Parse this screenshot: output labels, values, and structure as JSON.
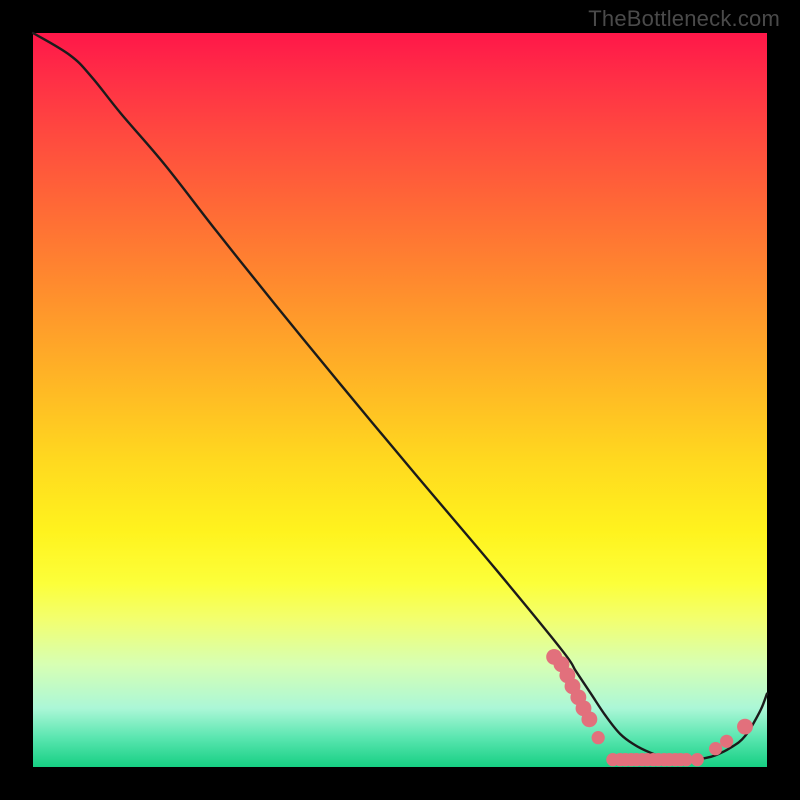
{
  "watermark": "TheBottleneck.com",
  "colors": {
    "background": "#000000",
    "curve_stroke": "#1b1b1b",
    "scatter_fill": "#e2707c",
    "gradient_top": "#ff1749",
    "gradient_bottom": "#16cf83"
  },
  "chart_data": {
    "type": "line",
    "title": "",
    "xlabel": "",
    "ylabel": "",
    "xlim": [
      0,
      100
    ],
    "ylim": [
      0,
      100
    ],
    "series": [
      {
        "name": "bottleneck-curve",
        "x": [
          0,
          5,
          8,
          12,
          18,
          25,
          33,
          42,
          52,
          63,
          72,
          74,
          76,
          78,
          80,
          82,
          84,
          86,
          88,
          90,
          91.5,
          93,
          95,
          97,
          99,
          100
        ],
        "y": [
          100,
          97,
          94,
          89,
          82,
          73,
          63,
          52,
          40,
          27,
          16,
          13,
          10,
          7,
          4.5,
          3,
          2,
          1.3,
          1,
          1,
          1.2,
          1.6,
          2.6,
          4.2,
          7.5,
          10
        ]
      }
    ],
    "scatter": {
      "name": "sweet-spot-markers",
      "points": [
        {
          "x": 71,
          "y": 15,
          "r": 1.2
        },
        {
          "x": 72,
          "y": 14,
          "r": 1.2
        },
        {
          "x": 72.8,
          "y": 12.5,
          "r": 1.2
        },
        {
          "x": 73.5,
          "y": 11,
          "r": 1.2
        },
        {
          "x": 74.3,
          "y": 9.5,
          "r": 1.2
        },
        {
          "x": 75,
          "y": 8,
          "r": 1.2
        },
        {
          "x": 75.8,
          "y": 6.5,
          "r": 1.2
        },
        {
          "x": 77,
          "y": 4,
          "r": 1.0
        },
        {
          "x": 79,
          "y": 1,
          "r": 1.0
        },
        {
          "x": 80,
          "y": 1,
          "r": 1.0
        },
        {
          "x": 80.7,
          "y": 1,
          "r": 1.0
        },
        {
          "x": 81.5,
          "y": 1,
          "r": 1.0
        },
        {
          "x": 82.2,
          "y": 1,
          "r": 1.0
        },
        {
          "x": 83,
          "y": 1,
          "r": 1.0
        },
        {
          "x": 83.7,
          "y": 1,
          "r": 1.0
        },
        {
          "x": 84.5,
          "y": 1,
          "r": 1.0
        },
        {
          "x": 85.2,
          "y": 1,
          "r": 1.0
        },
        {
          "x": 86,
          "y": 1,
          "r": 1.0
        },
        {
          "x": 86.7,
          "y": 1,
          "r": 1.0
        },
        {
          "x": 87.5,
          "y": 1,
          "r": 1.0
        },
        {
          "x": 88.2,
          "y": 1,
          "r": 1.0
        },
        {
          "x": 89,
          "y": 1,
          "r": 1.0
        },
        {
          "x": 90.5,
          "y": 1,
          "r": 1.0
        },
        {
          "x": 93,
          "y": 2.5,
          "r": 1.0
        },
        {
          "x": 94.5,
          "y": 3.5,
          "r": 1.0
        },
        {
          "x": 97,
          "y": 5.5,
          "r": 1.2
        }
      ]
    }
  }
}
